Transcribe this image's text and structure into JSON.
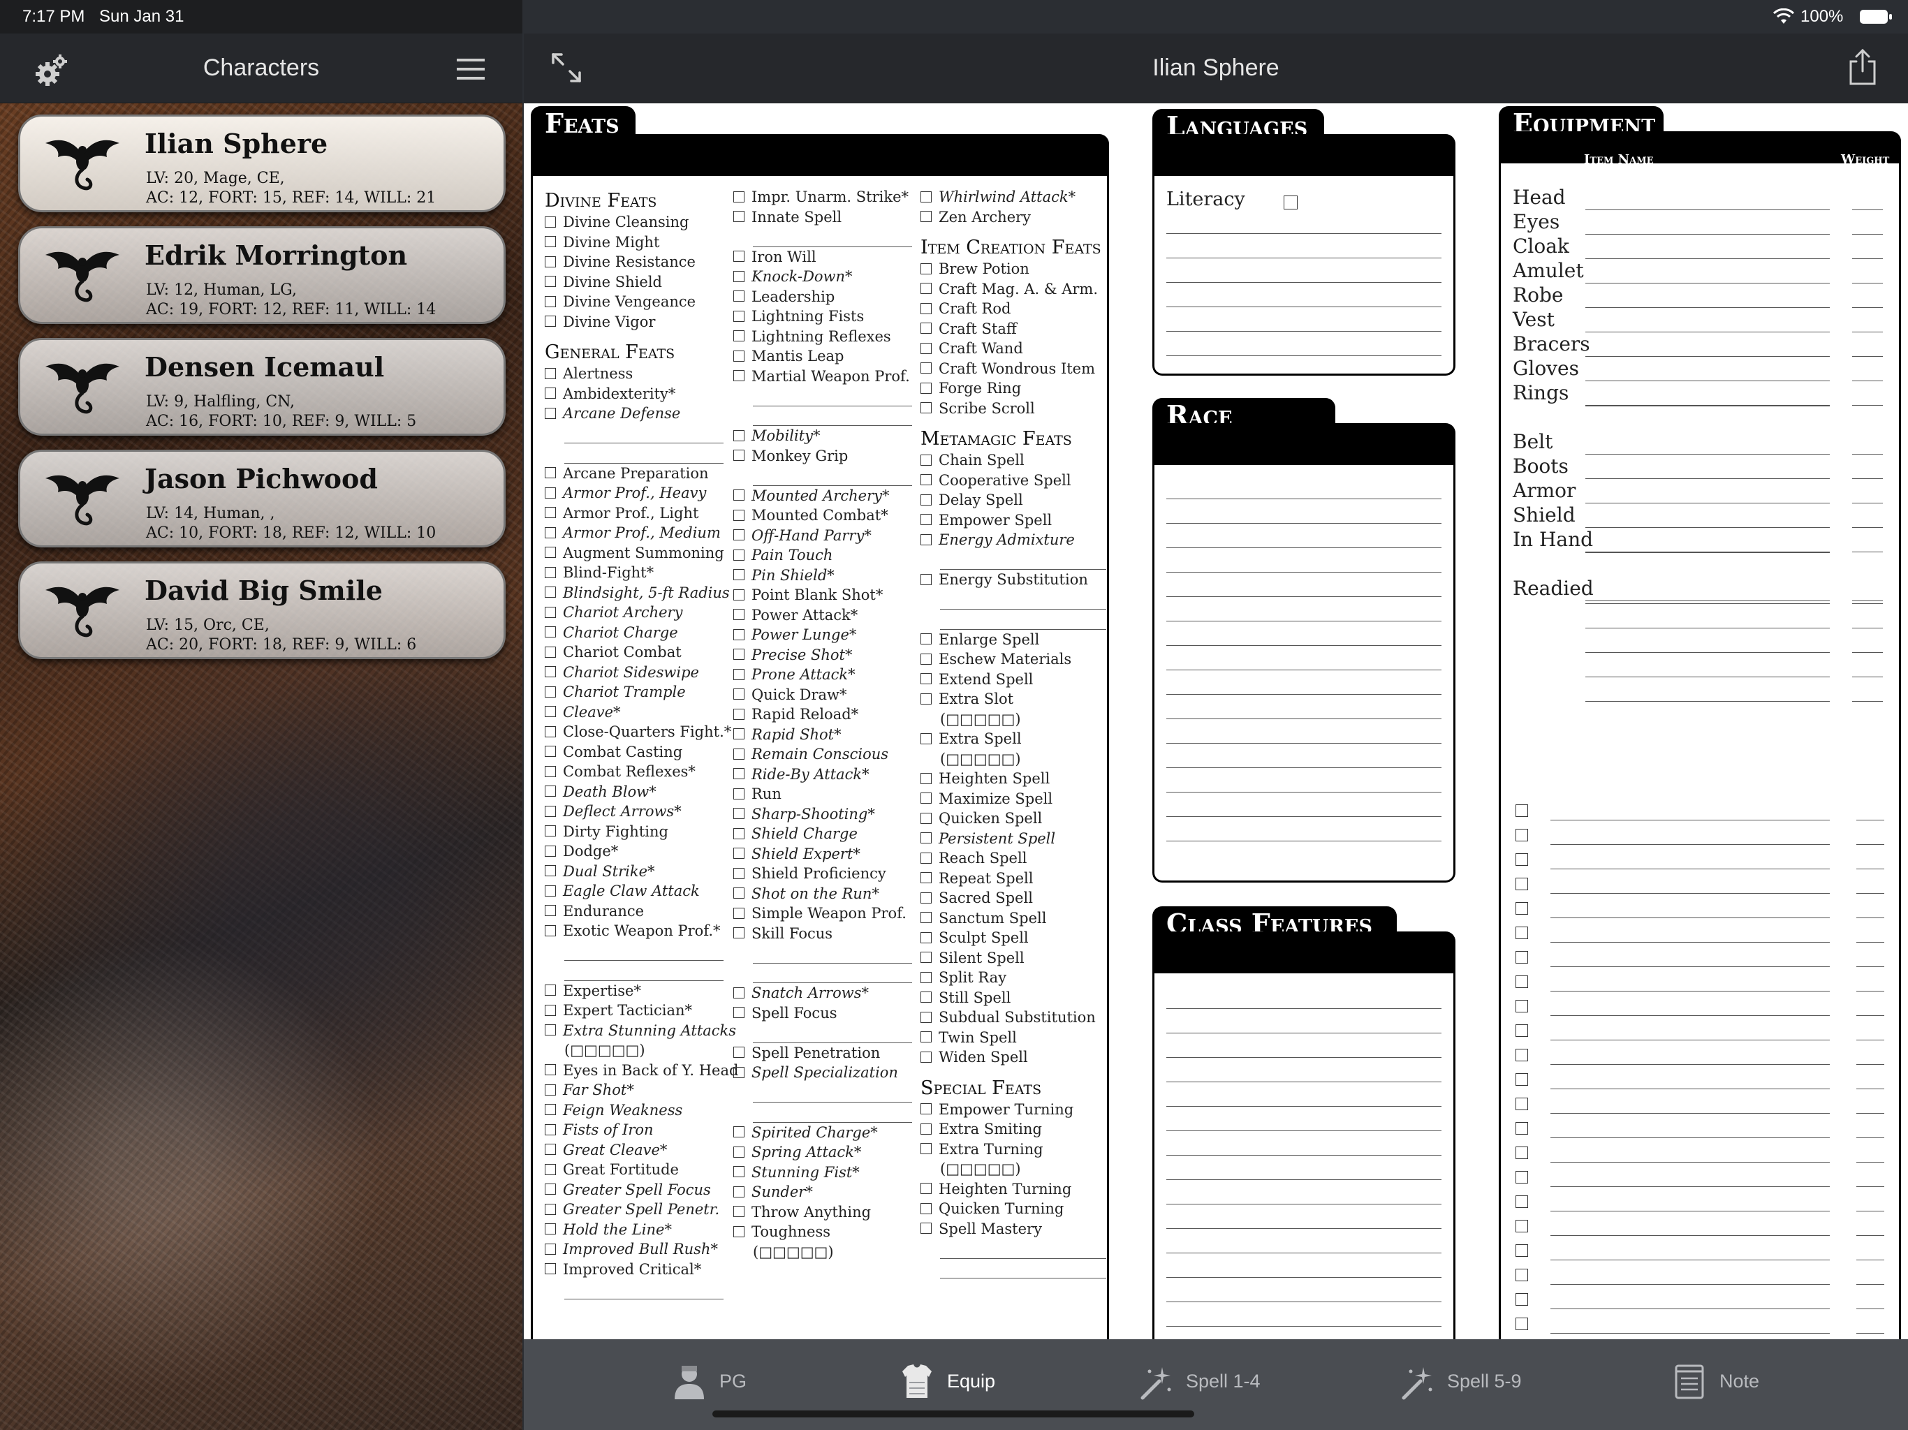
{
  "status": {
    "time": "7:17 PM",
    "date": "Sun Jan 31",
    "battery": "100%"
  },
  "sidebar": {
    "title": "Characters",
    "characters": [
      {
        "name": "Ilian Sphere",
        "line1": "LV: 20, Mage, CE,",
        "line2": "AC: 12, FORT: 15, REF: 14, WILL: 21"
      },
      {
        "name": "Edrik Morrington",
        "line1": "LV: 12, Human, LG,",
        "line2": "AC: 19, FORT: 12, REF: 11, WILL: 14"
      },
      {
        "name": "Densen Icemaul",
        "line1": "LV: 9, Halfling, CN,",
        "line2": "AC: 16, FORT: 10, REF: 9, WILL: 5"
      },
      {
        "name": "Jason Pichwood",
        "line1": "LV: 14, Human, ,",
        "line2": "AC: 10, FORT: 18, REF: 12, WILL: 10"
      },
      {
        "name": "David Big Smile",
        "line1": "LV: 15, Orc, CE,",
        "line2": "AC: 20, FORT: 18, REF: 9, WILL: 6"
      }
    ]
  },
  "main": {
    "title": "Ilian Sphere"
  },
  "sheet": {
    "feats_title": "Feats",
    "feats_columns": [
      [
        {
          "t": "h",
          "text": "Divine Feats"
        },
        {
          "text": "Divine Cleansing"
        },
        {
          "text": "Divine Might"
        },
        {
          "text": "Divine Resistance"
        },
        {
          "text": "Divine Shield"
        },
        {
          "text": "Divine Vengeance"
        },
        {
          "text": "Divine Vigor"
        },
        {
          "t": "h",
          "text": "General Feats"
        },
        {
          "text": "Alertness"
        },
        {
          "text": "Ambidexterity*"
        },
        {
          "text": "Arcane Defense",
          "i": true
        },
        {
          "t": "b"
        },
        {
          "t": "b"
        },
        {
          "text": "Arcane Preparation"
        },
        {
          "text": "Armor Prof., Heavy",
          "i": true
        },
        {
          "text": "Armor Prof., Light"
        },
        {
          "text": "Armor Prof., Medium",
          "i": true
        },
        {
          "text": "Augment Summoning"
        },
        {
          "text": "Blind-Fight*"
        },
        {
          "text": "Blindsight, 5-ft Radius",
          "i": true
        },
        {
          "text": "Chariot Archery",
          "i": true
        },
        {
          "text": "Chariot Charge",
          "i": true
        },
        {
          "text": "Chariot Combat"
        },
        {
          "text": "Chariot Sideswipe",
          "i": true
        },
        {
          "text": "Chariot Trample",
          "i": true
        },
        {
          "text": "Cleave*",
          "i": true
        },
        {
          "text": "Close-Quarters Fight.*"
        },
        {
          "text": "Combat Casting"
        },
        {
          "text": "Combat Reflexes*"
        },
        {
          "text": "Death Blow*",
          "i": true
        },
        {
          "text": "Deflect Arrows*",
          "i": true
        },
        {
          "text": "Dirty Fighting"
        },
        {
          "text": "Dodge*"
        },
        {
          "text": "Dual Strike*",
          "i": true
        },
        {
          "text": "Eagle Claw Attack",
          "i": true
        },
        {
          "text": "Endurance"
        },
        {
          "text": "Exotic Weapon Prof.*"
        },
        {
          "t": "b"
        },
        {
          "t": "b"
        },
        {
          "text": "Expertise*"
        },
        {
          "text": "Expert Tactician*"
        },
        {
          "text": "Extra Stunning Attacks",
          "i": true
        },
        {
          "t": "s",
          "text": "(□□□□□)"
        },
        {
          "text": "Eyes in Back of Y. Head"
        },
        {
          "text": "Far Shot*",
          "i": true
        },
        {
          "text": "Feign Weakness",
          "i": true
        },
        {
          "text": "Fists of Iron",
          "i": true
        },
        {
          "text": "Great Cleave*",
          "i": true
        },
        {
          "text": "Great Fortitude"
        },
        {
          "text": "Greater Spell Focus",
          "i": true
        },
        {
          "text": "Greater Spell Penetr.",
          "i": true
        },
        {
          "text": "Hold the Line*",
          "i": true
        },
        {
          "text": "Improved Bull Rush*",
          "i": true
        },
        {
          "text": "Improved Critical*"
        },
        {
          "t": "b"
        }
      ],
      [
        {
          "text": "Impr. Unarm. Strike*"
        },
        {
          "text": "Innate Spell"
        },
        {
          "t": "b"
        },
        {
          "text": "Iron Will"
        },
        {
          "text": "Knock-Down*",
          "i": true
        },
        {
          "text": "Leadership"
        },
        {
          "text": "Lightning Fists"
        },
        {
          "text": "Lightning Reflexes"
        },
        {
          "text": "Mantis Leap"
        },
        {
          "text": "Martial Weapon Prof."
        },
        {
          "t": "b"
        },
        {
          "t": "b"
        },
        {
          "text": "Mobility*",
          "i": true
        },
        {
          "text": "Monkey Grip"
        },
        {
          "t": "b"
        },
        {
          "text": "Mounted Archery*",
          "i": true
        },
        {
          "text": "Mounted Combat*"
        },
        {
          "text": "Off-Hand Parry*",
          "i": true
        },
        {
          "text": "Pain Touch",
          "i": true
        },
        {
          "text": "Pin Shield*",
          "i": true
        },
        {
          "text": "Point Blank Shot*"
        },
        {
          "text": "Power Attack*"
        },
        {
          "text": "Power Lunge*",
          "i": true
        },
        {
          "text": "Precise Shot*",
          "i": true
        },
        {
          "text": "Prone Attack*",
          "i": true
        },
        {
          "text": "Quick Draw*"
        },
        {
          "text": "Rapid Reload*"
        },
        {
          "text": "Rapid Shot*",
          "i": true
        },
        {
          "text": "Remain Conscious",
          "i": true
        },
        {
          "text": "Ride-By Attack*",
          "i": true
        },
        {
          "text": "Run"
        },
        {
          "text": "Sharp-Shooting*",
          "i": true
        },
        {
          "text": "Shield Charge",
          "i": true
        },
        {
          "text": "Shield Expert*",
          "i": true
        },
        {
          "text": "Shield Proficiency"
        },
        {
          "text": "Shot on the Run*",
          "i": true
        },
        {
          "text": "Simple Weapon Prof."
        },
        {
          "text": "Skill Focus"
        },
        {
          "t": "b"
        },
        {
          "t": "b"
        },
        {
          "text": "Snatch Arrows*",
          "i": true
        },
        {
          "text": "Spell Focus"
        },
        {
          "t": "b"
        },
        {
          "text": "Spell Penetration"
        },
        {
          "text": "Spell Specialization",
          "i": true
        },
        {
          "t": "b"
        },
        {
          "t": "b"
        },
        {
          "text": "Spirited Charge*",
          "i": true
        },
        {
          "text": "Spring Attack*",
          "i": true
        },
        {
          "text": "Stunning Fist*",
          "i": true
        },
        {
          "text": "Sunder*",
          "i": true
        },
        {
          "text": "Throw Anything"
        },
        {
          "text": "Toughness"
        },
        {
          "t": "s",
          "text": "(□□□□□)"
        }
      ],
      [
        {
          "text": "Whirlwind Attack*",
          "i": true
        },
        {
          "text": "Zen Archery"
        },
        {
          "t": "h",
          "text": "Item Creation Feats"
        },
        {
          "text": "Brew Potion"
        },
        {
          "text": "Craft Mag. A. & Arm."
        },
        {
          "text": "Craft Rod"
        },
        {
          "text": "Craft Staff"
        },
        {
          "text": "Craft Wand"
        },
        {
          "text": "Craft Wondrous Item"
        },
        {
          "text": "Forge Ring"
        },
        {
          "text": "Scribe Scroll"
        },
        {
          "t": "h",
          "text": "Metamagic Feats"
        },
        {
          "text": "Chain Spell"
        },
        {
          "text": "Cooperative Spell"
        },
        {
          "text": "Delay Spell"
        },
        {
          "text": "Empower Spell"
        },
        {
          "text": "Energy Admixture",
          "i": true
        },
        {
          "t": "b"
        },
        {
          "text": "Energy Substitution"
        },
        {
          "t": "b"
        },
        {
          "t": "b"
        },
        {
          "text": "Enlarge Spell"
        },
        {
          "text": "Eschew Materials"
        },
        {
          "text": "Extend Spell"
        },
        {
          "text": "Extra Slot"
        },
        {
          "t": "s",
          "text": "(□□□□□)"
        },
        {
          "text": "Extra Spell"
        },
        {
          "t": "s",
          "text": "(□□□□□)"
        },
        {
          "text": "Heighten Spell"
        },
        {
          "text": "Maximize Spell"
        },
        {
          "text": "Quicken Spell"
        },
        {
          "text": "Persistent Spell",
          "i": true
        },
        {
          "text": "Reach Spell"
        },
        {
          "text": "Repeat Spell"
        },
        {
          "text": "Sacred Spell"
        },
        {
          "text": "Sanctum Spell"
        },
        {
          "text": "Sculpt Spell"
        },
        {
          "text": "Silent Spell"
        },
        {
          "text": "Split Ray"
        },
        {
          "text": "Still Spell"
        },
        {
          "text": "Subdual Substitution"
        },
        {
          "text": "Twin Spell"
        },
        {
          "text": "Widen Spell"
        },
        {
          "t": "h",
          "text": "Special Feats"
        },
        {
          "text": "Empower Turning"
        },
        {
          "text": "Extra Smiting"
        },
        {
          "text": "Extra Turning"
        },
        {
          "t": "s",
          "text": "(□□□□□)"
        },
        {
          "text": "Heighten Turning"
        },
        {
          "text": "Quicken Turning"
        },
        {
          "text": "Spell Mastery"
        },
        {
          "t": "b"
        },
        {
          "t": "b"
        }
      ]
    ],
    "languages": {
      "title": "Languages",
      "literacy_label": "Literacy"
    },
    "race_traits": {
      "title": "Race Traits"
    },
    "class_features": {
      "title": "Class Features"
    },
    "equipment": {
      "title": "Equipment",
      "item_header": "Item Name",
      "weight_header": "Weight",
      "slots": [
        "Head",
        "Eyes",
        "Cloak",
        "Amulet",
        "Robe",
        "Vest",
        "Bracers",
        "Gloves",
        "Rings",
        "Belt",
        "Boots",
        "Armor",
        "Shield",
        "In Hand",
        "Readied"
      ]
    }
  },
  "tabs": [
    {
      "label": "PG",
      "icon": "person-icon"
    },
    {
      "label": "Equip",
      "icon": "armor-icon",
      "active": true
    },
    {
      "label": "Spell 1-4",
      "icon": "magic-wand-icon"
    },
    {
      "label": "Spell 5-9",
      "icon": "magic-wand-icon"
    },
    {
      "label": "Note",
      "icon": "notes-icon"
    }
  ]
}
